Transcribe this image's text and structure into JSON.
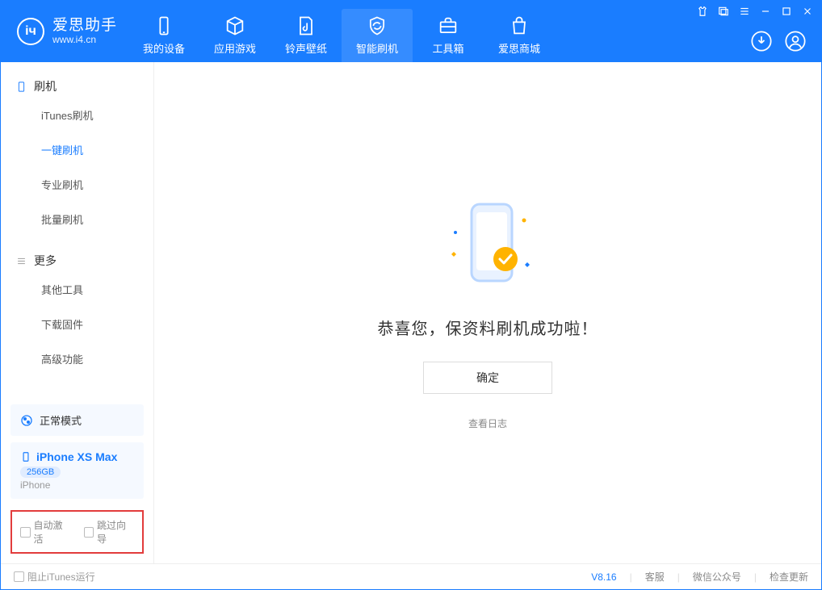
{
  "app": {
    "name": "爱思助手",
    "url": "www.i4.cn"
  },
  "nav": {
    "items": [
      {
        "label": "我的设备"
      },
      {
        "label": "应用游戏"
      },
      {
        "label": "铃声壁纸"
      },
      {
        "label": "智能刷机",
        "active": true
      },
      {
        "label": "工具箱"
      },
      {
        "label": "爱思商城"
      }
    ]
  },
  "sidebar": {
    "section1": "刷机",
    "items1": [
      {
        "label": "iTunes刷机"
      },
      {
        "label": "一键刷机",
        "active": true
      },
      {
        "label": "专业刷机"
      },
      {
        "label": "批量刷机"
      }
    ],
    "section2": "更多",
    "items2": [
      {
        "label": "其他工具"
      },
      {
        "label": "下载固件"
      },
      {
        "label": "高级功能"
      }
    ],
    "mode": "正常模式",
    "device": {
      "name": "iPhone XS Max",
      "storage": "256GB",
      "type": "iPhone"
    },
    "checks": {
      "autoActivate": "自动激活",
      "skipGuide": "跳过向导"
    }
  },
  "main": {
    "success": "恭喜您，保资料刷机成功啦！",
    "ok": "确定",
    "viewLog": "查看日志"
  },
  "footer": {
    "blockItunes": "阻止iTunes运行",
    "version": "V8.16",
    "links": {
      "support": "客服",
      "wechat": "微信公众号",
      "update": "检查更新"
    }
  }
}
